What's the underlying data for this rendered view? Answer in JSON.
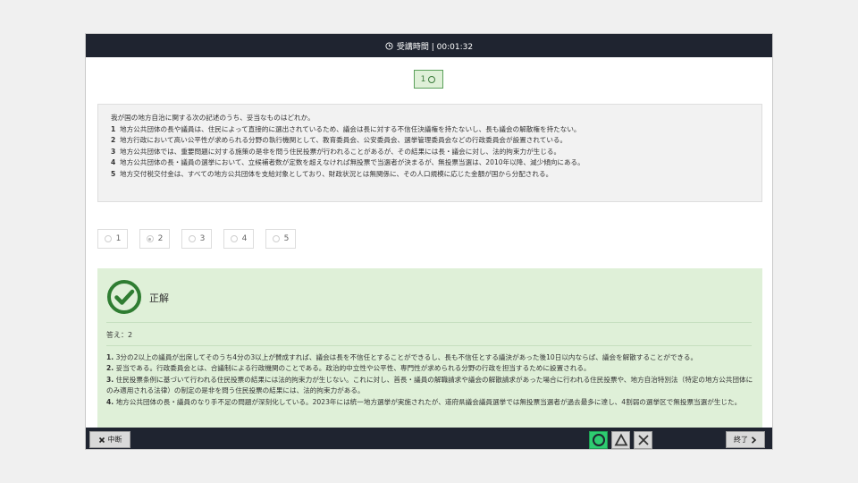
{
  "header": {
    "timer_label": "受講時間 | 00:01:32",
    "clock_icon": "clock-icon"
  },
  "question_number": "1",
  "question": {
    "stem": "我が国の地方自治に関する次の記述のうち、妥当なものはどれか。",
    "options": [
      {
        "num": "1",
        "text": "地方公共団体の長や議員は、住民によって直接的に選出されているため、議会は長に対する不信任決議権を持たないし、長も議会の解散権を持たない。"
      },
      {
        "num": "2",
        "text": "地方行政において高い公平性が求められる分野の執行機関として、教育委員会、公安委員会、選挙管理委員会などの行政委員会が設置されている。"
      },
      {
        "num": "3",
        "text": "地方公共団体では、重要問題に対する施策の是非を問う住民投票が行われることがあるが、その結果には長・議会に対し、法的拘束力が生じる。"
      },
      {
        "num": "4",
        "text": "地方公共団体の長・議員の選挙において、立候補者数が定数を超えなければ無投票で当選者が決まるが、無投票当選は、2010年以降、減少傾向にある。"
      },
      {
        "num": "5",
        "text": "地方交付税交付金は、すべての地方公共団体を支給対象としており、財政状況とは無関係に、その人口規模に応じた金額が国から分配される。"
      }
    ]
  },
  "choices": [
    {
      "label": "1",
      "selected": false
    },
    {
      "label": "2",
      "selected": true
    },
    {
      "label": "3",
      "selected": false
    },
    {
      "label": "4",
      "selected": false
    },
    {
      "label": "5",
      "selected": false
    }
  ],
  "result": {
    "title": "正解",
    "answer": "答え：2",
    "explanations": [
      {
        "num": "1.",
        "text": "3分の2以上の議員が出席してそのうち4分の3以上が賛成すれば、議会は長を不信任とすることができるし、長も不信任とする議決があった後10日以内ならば、議会を解散することができる。"
      },
      {
        "num": "2.",
        "text": "妥当である。行政委員会とは、合議制による行政機関のことである。政治的中立性や公平性、専門性が求められる分野の行政を担当するために設置される。"
      },
      {
        "num": "3.",
        "text": "住民投票条例に基づいて行われる住民投票の結果には法的拘束力が生じない。これに対し、首長・議員の解職請求や議会の解散請求があった場合に行われる住民投票や、地方自治特別法（特定の地方公共団体にのみ適用される法律）の制定の是非を問う住民投票の結果には、法的拘束力がある。"
      },
      {
        "num": "4.",
        "text": "地方公共団体の長・議員のなり手不足の問題が深刻化している。2023年には統一地方選挙が実施されたが、道府県議会議員選挙では無投票当選者が過去最多に達し、4割弱の選挙区で無投票当選が生じた。"
      }
    ]
  },
  "footer": {
    "suspend_label": "中断",
    "finish_label": "終了",
    "marks": [
      "circle-icon",
      "triangle-icon",
      "cross-icon"
    ]
  },
  "colors": {
    "accent_green": "#2f7d32",
    "header_dark": "#1f2430",
    "result_bg": "#dff0d8",
    "selected_mark": "#2ecc71"
  }
}
